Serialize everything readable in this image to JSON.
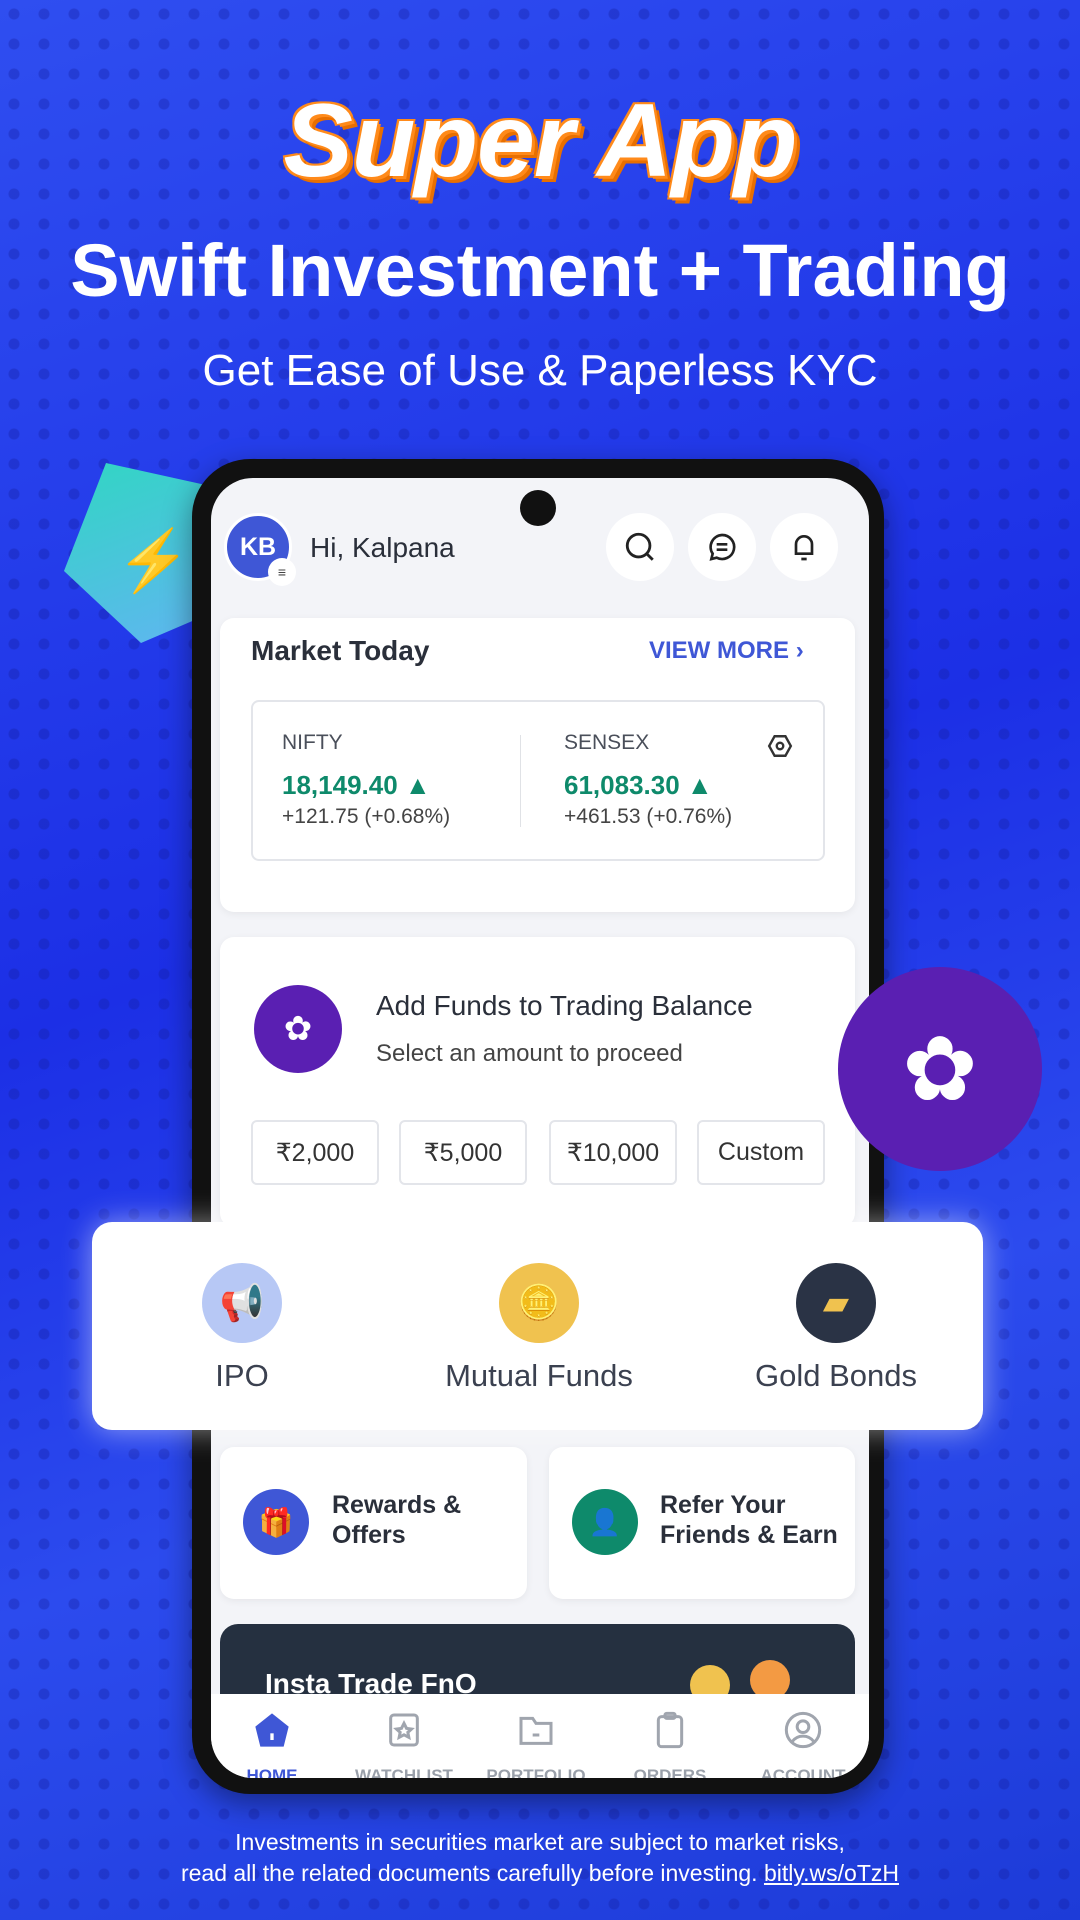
{
  "promo": {
    "title": "Super App",
    "headline": "Swift Investment + Trading",
    "subtitle": "Get Ease of Use & Paperless KYC"
  },
  "header": {
    "avatar_initials": "KB",
    "greeting": "Hi, Kalpana",
    "icons": [
      "search-icon",
      "chat-icon",
      "bell-icon"
    ]
  },
  "market": {
    "title": "Market Today",
    "view_more": "VIEW MORE",
    "indices": [
      {
        "name": "NIFTY",
        "value": "18,149.40",
        "change": "+121.75 (+0.68%)",
        "trend": "up"
      },
      {
        "name": "SENSEX",
        "value": "61,083.30",
        "change": "+461.53 (+0.76%)",
        "trend": "up"
      }
    ]
  },
  "funds": {
    "title": "Add Funds to Trading Balance",
    "subtitle": "Select an amount to proceed",
    "amounts": [
      "₹2,000",
      "₹5,000",
      "₹10,000",
      "Custom"
    ]
  },
  "quick": [
    {
      "label": "IPO",
      "icon": "megaphone-icon"
    },
    {
      "label": "Mutual Funds",
      "icon": "coins-icon"
    },
    {
      "label": "Gold Bonds",
      "icon": "gold-bars-icon"
    }
  ],
  "tiles": [
    {
      "label": "Rewards & Offers",
      "icon": "gift-icon"
    },
    {
      "label": "Refer Your Friends & Earn",
      "icon": "refer-user-icon"
    }
  ],
  "banner": {
    "title": "Insta Trade FnO"
  },
  "nav": [
    "HOME",
    "WATCHLIST",
    "PORTFOLIO",
    "ORDERS",
    "ACCOUNT"
  ],
  "disclaimer": {
    "line1": "Investments in securities market are subject to market risks,",
    "line2": "read all the related  documents carefully before investing.",
    "link": "bitly.ws/oTzH"
  },
  "colors": {
    "accent": "#3f57d6",
    "up": "#0e8a6b",
    "purple": "#5a1fb2",
    "orange": "#ff8a1a"
  }
}
